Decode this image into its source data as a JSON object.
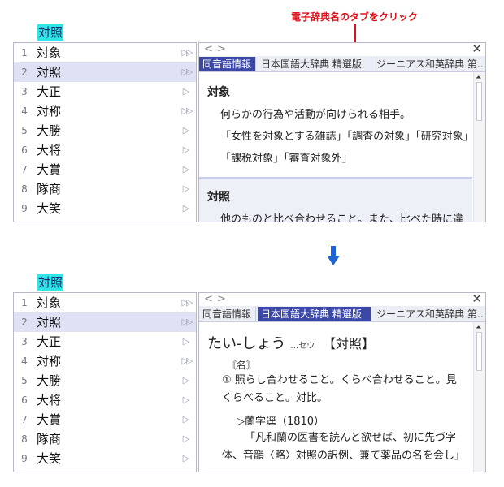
{
  "annotation": {
    "text": "電子辞典名のタブをクリック",
    "color": "#e0101a"
  },
  "preedit": "対照",
  "candidates": [
    {
      "num": "1",
      "text": "対象",
      "arrow": "▷▷"
    },
    {
      "num": "2",
      "text": "対照",
      "arrow": "▷▷",
      "selected": true
    },
    {
      "num": "3",
      "text": "大正",
      "arrow": "▷"
    },
    {
      "num": "4",
      "text": "対称",
      "arrow": "▷▷"
    },
    {
      "num": "5",
      "text": "大勝",
      "arrow": "▷"
    },
    {
      "num": "6",
      "text": "大将",
      "arrow": "▷"
    },
    {
      "num": "7",
      "text": "大賞",
      "arrow": "▷"
    },
    {
      "num": "8",
      "text": "隊商",
      "arrow": "▷"
    },
    {
      "num": "9",
      "text": "大笑",
      "arrow": "▷"
    }
  ],
  "dict_nav": {
    "back": "<",
    "forward": ">",
    "close": "✕"
  },
  "tabs": [
    "同音語情報",
    "日本国語大辞典 精選版",
    "ジーニアス和英辞典 第…"
  ],
  "top_panel": {
    "active_tab": 0,
    "entry1_title": "対象",
    "entry1_senses": [
      "何らかの行為や活動が向けられる相手。",
      "「女性を対象とする雑誌」「調査の対象」「研究対象」",
      "「課税対象」「審査対象外」"
    ],
    "entry2_title": "対照",
    "entry2_sense": "他のものと比べ合わせること。また、比べた時に違いが"
  },
  "bottom_panel": {
    "active_tab": 1,
    "reading": "たい-しょう",
    "reading_sub": "…セウ",
    "headword": "【対照】",
    "pos": "〘名〙",
    "definition": "① 照らし合わせること。くらべ合わせること。見くらべること。対比。",
    "quote_source": "▷蘭学逕（1810）",
    "quote": "「凡和蘭の医書を読んと欲せば、初に先づ字体、音韻〈略〉対照の訳例、兼て薬品の名を会し」"
  },
  "colors": {
    "active_tab": "#3c48a8",
    "preedit_highlight": "#2fe6e6",
    "selected_row": "#dfe2f5",
    "arrow": "#1f63d6"
  }
}
